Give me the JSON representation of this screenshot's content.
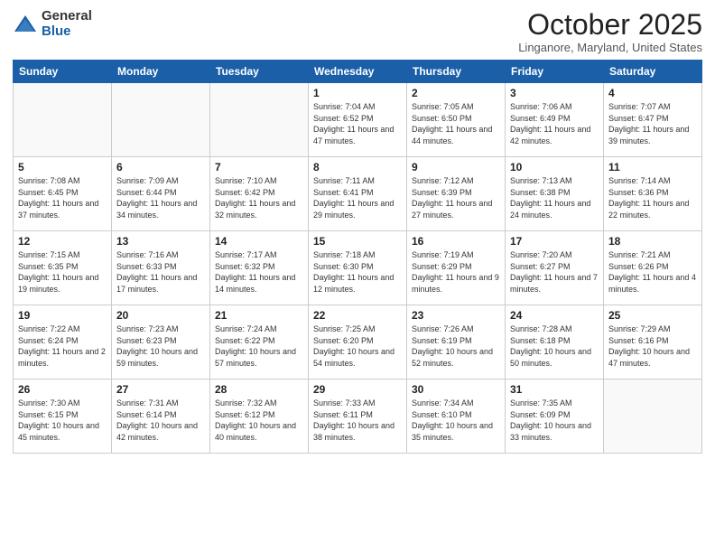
{
  "logo": {
    "general": "General",
    "blue": "Blue"
  },
  "header": {
    "month": "October 2025",
    "location": "Linganore, Maryland, United States"
  },
  "days_of_week": [
    "Sunday",
    "Monday",
    "Tuesday",
    "Wednesday",
    "Thursday",
    "Friday",
    "Saturday"
  ],
  "weeks": [
    [
      {
        "day": "",
        "info": ""
      },
      {
        "day": "",
        "info": ""
      },
      {
        "day": "",
        "info": ""
      },
      {
        "day": "1",
        "info": "Sunrise: 7:04 AM\nSunset: 6:52 PM\nDaylight: 11 hours and 47 minutes."
      },
      {
        "day": "2",
        "info": "Sunrise: 7:05 AM\nSunset: 6:50 PM\nDaylight: 11 hours and 44 minutes."
      },
      {
        "day": "3",
        "info": "Sunrise: 7:06 AM\nSunset: 6:49 PM\nDaylight: 11 hours and 42 minutes."
      },
      {
        "day": "4",
        "info": "Sunrise: 7:07 AM\nSunset: 6:47 PM\nDaylight: 11 hours and 39 minutes."
      }
    ],
    [
      {
        "day": "5",
        "info": "Sunrise: 7:08 AM\nSunset: 6:45 PM\nDaylight: 11 hours and 37 minutes."
      },
      {
        "day": "6",
        "info": "Sunrise: 7:09 AM\nSunset: 6:44 PM\nDaylight: 11 hours and 34 minutes."
      },
      {
        "day": "7",
        "info": "Sunrise: 7:10 AM\nSunset: 6:42 PM\nDaylight: 11 hours and 32 minutes."
      },
      {
        "day": "8",
        "info": "Sunrise: 7:11 AM\nSunset: 6:41 PM\nDaylight: 11 hours and 29 minutes."
      },
      {
        "day": "9",
        "info": "Sunrise: 7:12 AM\nSunset: 6:39 PM\nDaylight: 11 hours and 27 minutes."
      },
      {
        "day": "10",
        "info": "Sunrise: 7:13 AM\nSunset: 6:38 PM\nDaylight: 11 hours and 24 minutes."
      },
      {
        "day": "11",
        "info": "Sunrise: 7:14 AM\nSunset: 6:36 PM\nDaylight: 11 hours and 22 minutes."
      }
    ],
    [
      {
        "day": "12",
        "info": "Sunrise: 7:15 AM\nSunset: 6:35 PM\nDaylight: 11 hours and 19 minutes."
      },
      {
        "day": "13",
        "info": "Sunrise: 7:16 AM\nSunset: 6:33 PM\nDaylight: 11 hours and 17 minutes."
      },
      {
        "day": "14",
        "info": "Sunrise: 7:17 AM\nSunset: 6:32 PM\nDaylight: 11 hours and 14 minutes."
      },
      {
        "day": "15",
        "info": "Sunrise: 7:18 AM\nSunset: 6:30 PM\nDaylight: 11 hours and 12 minutes."
      },
      {
        "day": "16",
        "info": "Sunrise: 7:19 AM\nSunset: 6:29 PM\nDaylight: 11 hours and 9 minutes."
      },
      {
        "day": "17",
        "info": "Sunrise: 7:20 AM\nSunset: 6:27 PM\nDaylight: 11 hours and 7 minutes."
      },
      {
        "day": "18",
        "info": "Sunrise: 7:21 AM\nSunset: 6:26 PM\nDaylight: 11 hours and 4 minutes."
      }
    ],
    [
      {
        "day": "19",
        "info": "Sunrise: 7:22 AM\nSunset: 6:24 PM\nDaylight: 11 hours and 2 minutes."
      },
      {
        "day": "20",
        "info": "Sunrise: 7:23 AM\nSunset: 6:23 PM\nDaylight: 10 hours and 59 minutes."
      },
      {
        "day": "21",
        "info": "Sunrise: 7:24 AM\nSunset: 6:22 PM\nDaylight: 10 hours and 57 minutes."
      },
      {
        "day": "22",
        "info": "Sunrise: 7:25 AM\nSunset: 6:20 PM\nDaylight: 10 hours and 54 minutes."
      },
      {
        "day": "23",
        "info": "Sunrise: 7:26 AM\nSunset: 6:19 PM\nDaylight: 10 hours and 52 minutes."
      },
      {
        "day": "24",
        "info": "Sunrise: 7:28 AM\nSunset: 6:18 PM\nDaylight: 10 hours and 50 minutes."
      },
      {
        "day": "25",
        "info": "Sunrise: 7:29 AM\nSunset: 6:16 PM\nDaylight: 10 hours and 47 minutes."
      }
    ],
    [
      {
        "day": "26",
        "info": "Sunrise: 7:30 AM\nSunset: 6:15 PM\nDaylight: 10 hours and 45 minutes."
      },
      {
        "day": "27",
        "info": "Sunrise: 7:31 AM\nSunset: 6:14 PM\nDaylight: 10 hours and 42 minutes."
      },
      {
        "day": "28",
        "info": "Sunrise: 7:32 AM\nSunset: 6:12 PM\nDaylight: 10 hours and 40 minutes."
      },
      {
        "day": "29",
        "info": "Sunrise: 7:33 AM\nSunset: 6:11 PM\nDaylight: 10 hours and 38 minutes."
      },
      {
        "day": "30",
        "info": "Sunrise: 7:34 AM\nSunset: 6:10 PM\nDaylight: 10 hours and 35 minutes."
      },
      {
        "day": "31",
        "info": "Sunrise: 7:35 AM\nSunset: 6:09 PM\nDaylight: 10 hours and 33 minutes."
      },
      {
        "day": "",
        "info": ""
      }
    ]
  ]
}
